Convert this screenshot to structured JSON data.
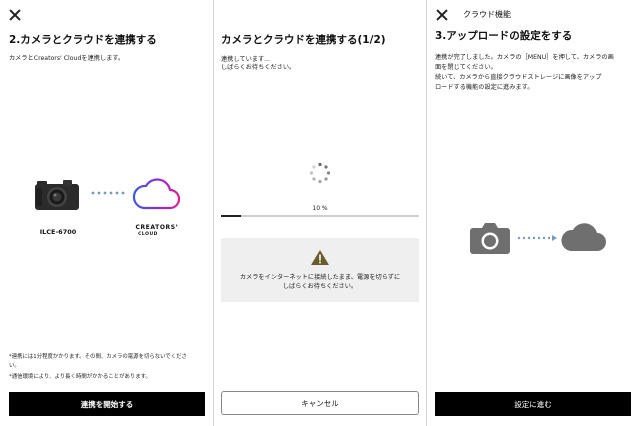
{
  "screen1": {
    "heading": "2.カメラとクラウドを連携する",
    "description": "カメラとCreators' Cloudを連携します。",
    "camera_label": "ILCE-6700",
    "cloud_brand_line1": "CREATORS’",
    "cloud_brand_line2": "CLOUD",
    "notes": [
      "*連携には1分程度かかります。その間、カメラの電源を切らないでくださ",
      "い。",
      "*通信環境により、より長く時間がかかることがあります。"
    ],
    "start_button_label": "連携を開始する"
  },
  "screen2": {
    "heading": "カメラとクラウドを連携する(1/2)",
    "status_lines": [
      "連携しています...",
      "しばらくお待ちください。"
    ],
    "progress_text": "10 %",
    "progress_value": 0.1,
    "warning_lines": [
      "カメラをインターネットに接続したまま、電源を切らずに",
      "しばらくお待ちください。"
    ],
    "cancel_button_label": "キャンセル"
  },
  "screen3": {
    "header_title": "クラウド機能",
    "heading": "3.アップロードの設定をする",
    "body_lines": [
      "連携が完了しました。カメラの［MENU］を押して、カメラの画",
      "面を閉じてください。",
      "続いて、カメラから直接クラウドストレージに画像をアップ",
      "ロードする機能の設定に進みます。"
    ],
    "next_button_label": "設定に進む"
  },
  "icons": {
    "close": "close-icon",
    "camera_photo": "camera-photo",
    "cloud_logo": "creators-cloud-logo-icon",
    "spinner": "loading-spinner-icon",
    "warning": "warning-icon",
    "camera_glyph": "camera-icon",
    "cloud_glyph": "cloud-icon",
    "dots": "dotted-connector-icon"
  },
  "colors": {
    "primary": "#000000",
    "warning_panel": "#efefef",
    "progress_fill": "#222222",
    "icon_gray": "#6f6f6f",
    "connector": "#7a9ab8",
    "cloud_gradient_start": "#3a5bd9",
    "cloud_gradient_mid": "#8a2be2",
    "cloud_gradient_end": "#e0218a"
  }
}
